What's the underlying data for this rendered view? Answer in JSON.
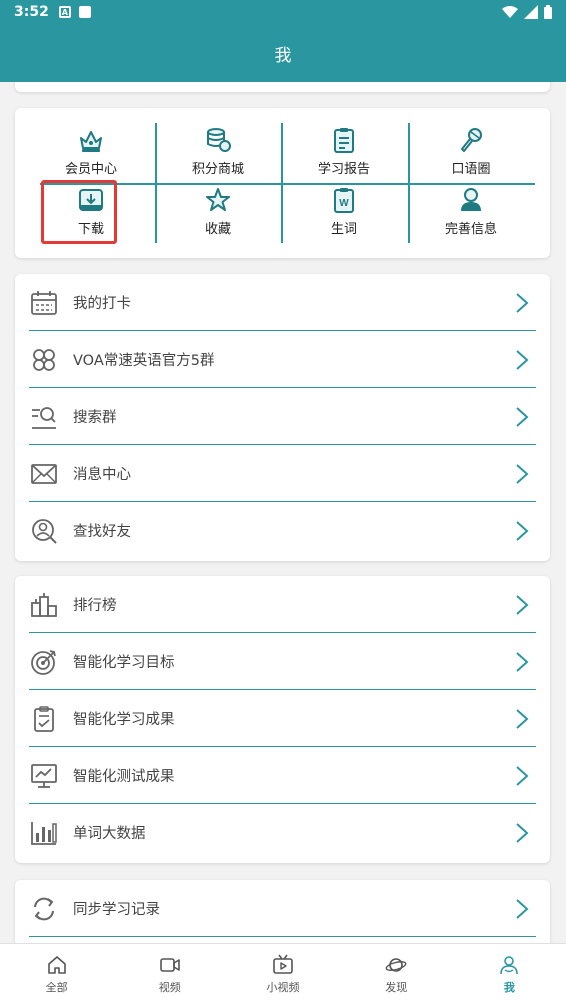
{
  "status": {
    "time": "3:52",
    "badge": "A"
  },
  "header": {
    "title": "我"
  },
  "grid": [
    {
      "label": "会员中心",
      "icon": "crown-icon"
    },
    {
      "label": "积分商城",
      "icon": "coins-icon"
    },
    {
      "label": "学习报告",
      "icon": "report-icon"
    },
    {
      "label": "口语圈",
      "icon": "microphone-icon"
    },
    {
      "label": "下载",
      "icon": "download-icon"
    },
    {
      "label": "收藏",
      "icon": "star-icon"
    },
    {
      "label": "生词",
      "icon": "word-card-icon"
    },
    {
      "label": "完善信息",
      "icon": "profile-icon"
    }
  ],
  "list1": [
    {
      "label": "我的打卡",
      "icon": "calendar-icon"
    },
    {
      "label": "VOA常速英语官方5群",
      "icon": "group-icon"
    },
    {
      "label": "搜索群",
      "icon": "search-list-icon"
    },
    {
      "label": "消息中心",
      "icon": "mail-icon"
    },
    {
      "label": "查找好友",
      "icon": "find-friend-icon"
    }
  ],
  "list2": [
    {
      "label": "排行榜",
      "icon": "leaderboard-icon"
    },
    {
      "label": "智能化学习目标",
      "icon": "target-icon"
    },
    {
      "label": "智能化学习成果",
      "icon": "clipboard-check-icon"
    },
    {
      "label": "智能化测试成果",
      "icon": "presentation-chart-icon"
    },
    {
      "label": "单词大数据",
      "icon": "bar-chart-icon"
    }
  ],
  "list3": [
    {
      "label": "同步学习记录",
      "icon": "sync-icon"
    }
  ],
  "nav": [
    {
      "label": "全部",
      "icon": "home-icon"
    },
    {
      "label": "视频",
      "icon": "video-icon"
    },
    {
      "label": "小视频",
      "icon": "tv-icon"
    },
    {
      "label": "发现",
      "icon": "planet-icon"
    },
    {
      "label": "我",
      "icon": "me-icon"
    }
  ],
  "colors": {
    "accent": "#2a97a0",
    "highlight": "#e53935"
  }
}
